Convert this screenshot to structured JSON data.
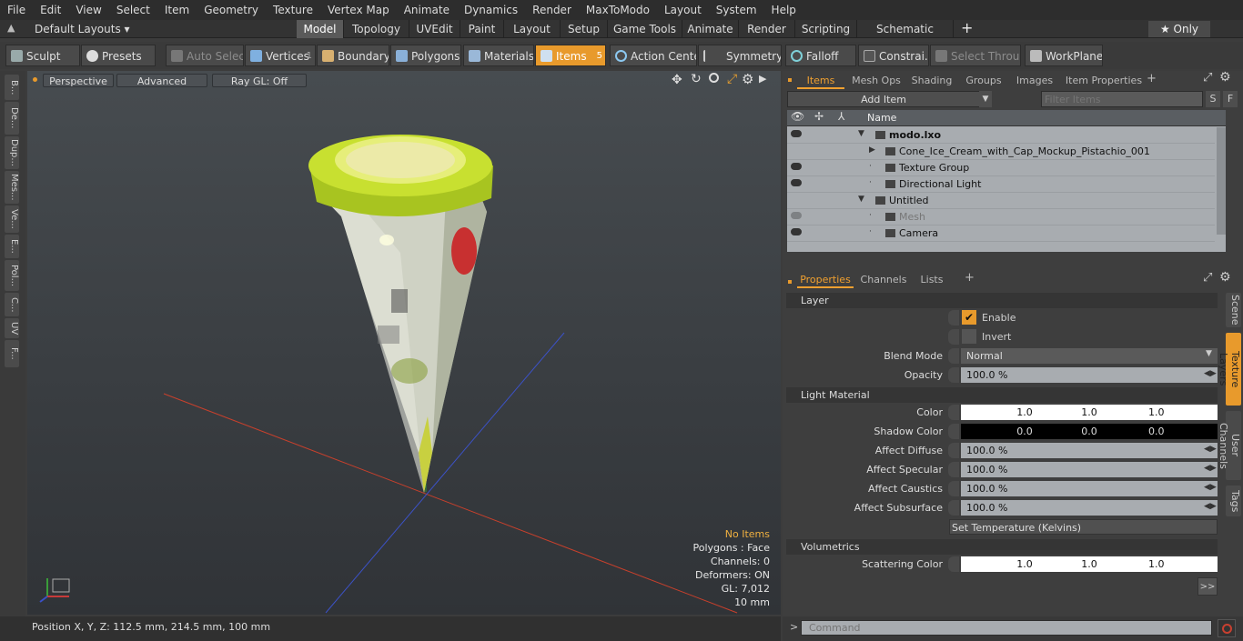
{
  "menu": [
    "File",
    "Edit",
    "View",
    "Select",
    "Item",
    "Geometry",
    "Texture",
    "Vertex Map",
    "Animate",
    "Dynamics",
    "Render",
    "MaxToModo",
    "Layout",
    "System",
    "Help"
  ],
  "layout_bar": {
    "preset": "Default Layouts ▾",
    "tabs": [
      "Model",
      "Topology",
      "UVEdit",
      "Paint",
      "Layout",
      "Setup",
      "Game Tools",
      "Animate",
      "Render",
      "Scripting",
      "Schematic Fusion"
    ],
    "active_tab": "Model",
    "add": "+",
    "only": "★ Only"
  },
  "toolbar": {
    "sculpt": "Sculpt",
    "presets": "Presets",
    "auto_select": "Auto Select",
    "vertices": "Vertices",
    "vertices_count": "1",
    "boundary": "Boundary",
    "polygons": "Polygons",
    "materials": "Materials",
    "items": "Items",
    "items_count": "5",
    "action_center": "Action Center",
    "symmetry": "Symmetry",
    "falloff": "Falloff",
    "constraints": "Constrai...",
    "select_through": "Select Through",
    "workplane": "WorkPlane"
  },
  "left_tabs": [
    "B...",
    "De...",
    "Dup...",
    "Mes...",
    "Ve...",
    "E...",
    "Pol...",
    "C...",
    "UV",
    "F..."
  ],
  "viewport": {
    "view": "Perspective",
    "shading": "Advanced",
    "raygl": "Ray GL: Off",
    "stats": {
      "items": "No Items",
      "polygons": "Polygons : Face",
      "channels": "Channels: 0",
      "deformers": "Deformers: ON",
      "gl": "GL: 7,012",
      "scale": "10 mm"
    }
  },
  "status": "Position X, Y, Z:   112.5 mm, 214.5 mm, 100 mm",
  "items_panel": {
    "tabs": [
      "Items",
      "Mesh Ops",
      "Shading",
      "Groups",
      "Images",
      "Item Properties"
    ],
    "active_tab": "Items",
    "add_item": "Add Item",
    "filter_placeholder": "Filter Items",
    "s": "S",
    "f": "F",
    "col_name": "Name",
    "tree": [
      {
        "label": "modo.lxo",
        "bold": true,
        "eye": true,
        "indent": 0
      },
      {
        "label": "Cone_Ice_Cream_with_Cap_Mockup_Pistachio_001",
        "eye": false,
        "indent": 1
      },
      {
        "label": "Texture Group",
        "eye": true,
        "indent": 1
      },
      {
        "label": "Directional Light",
        "eye": true,
        "indent": 1
      },
      {
        "label": "Untitled",
        "eye": false,
        "indent": 0
      },
      {
        "label": "Mesh",
        "eye": true,
        "indent": 1,
        "dim": true
      },
      {
        "label": "Camera",
        "eye": true,
        "indent": 1
      }
    ]
  },
  "props_panel": {
    "tabs": [
      "Properties",
      "Channels",
      "Lists"
    ],
    "active_tab": "Properties",
    "add": "+",
    "side_tabs": [
      "Scene",
      "Texture Layers",
      "User Channels",
      "Tags"
    ],
    "sections": {
      "layer": "Layer",
      "light_material": "Light Material",
      "volumetrics": "Volumetrics"
    },
    "enable": "Enable",
    "invert": "Invert",
    "blend_mode_label": "Blend Mode",
    "blend_mode": "Normal",
    "opacity_label": "Opacity",
    "opacity": "100.0 %",
    "color_label": "Color",
    "color": [
      "1.0",
      "1.0",
      "1.0"
    ],
    "shadow_label": "Shadow Color",
    "shadow": [
      "0.0",
      "0.0",
      "0.0"
    ],
    "affect_diffuse_label": "Affect Diffuse",
    "affect_diffuse": "100.0 %",
    "affect_specular_label": "Affect Specular",
    "affect_specular": "100.0 %",
    "affect_caustics_label": "Affect Caustics",
    "affect_caustics": "100.0 %",
    "affect_subsurface_label": "Affect Subsurface",
    "affect_subsurface": "100.0 %",
    "set_temp": "Set Temperature (Kelvins)",
    "scatter_label": "Scattering Color",
    "scatter": [
      "1.0",
      "1.0",
      "1.0"
    ],
    "more": ">>"
  },
  "command": {
    "prompt": ">",
    "placeholder": "Command"
  },
  "colors": {
    "accent": "#f0a030",
    "cap": "#c9e035"
  }
}
